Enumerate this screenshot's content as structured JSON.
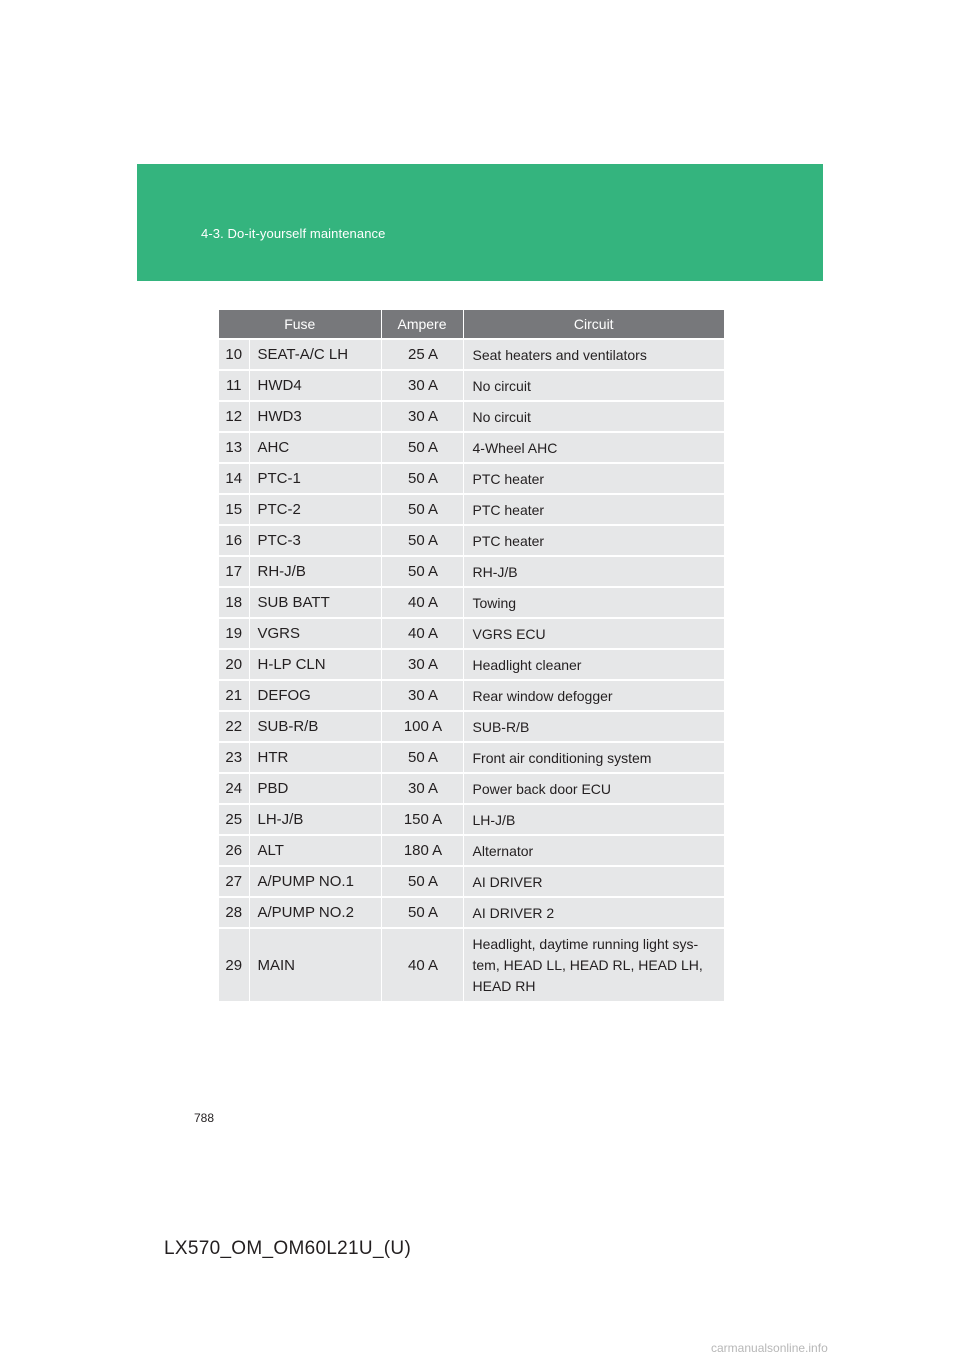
{
  "header": {
    "section": "4-3. Do-it-yourself maintenance",
    "band_color": "#34b47e"
  },
  "table": {
    "columns": [
      "Fuse",
      "Ampere",
      "Circuit"
    ],
    "header_color": "#77787b",
    "row_color": "#e6e7e8",
    "rows": [
      {
        "num": "10",
        "fuse": "SEAT-A/C LH",
        "ampere": "25 A",
        "circuit": "Seat heaters and ventilators"
      },
      {
        "num": "11",
        "fuse": "HWD4",
        "ampere": "30 A",
        "circuit": "No circuit"
      },
      {
        "num": "12",
        "fuse": "HWD3",
        "ampere": "30 A",
        "circuit": "No circuit"
      },
      {
        "num": "13",
        "fuse": "AHC",
        "ampere": "50 A",
        "circuit": "4-Wheel AHC"
      },
      {
        "num": "14",
        "fuse": "PTC-1",
        "ampere": "50 A",
        "circuit": "PTC heater"
      },
      {
        "num": "15",
        "fuse": "PTC-2",
        "ampere": "50 A",
        "circuit": "PTC heater"
      },
      {
        "num": "16",
        "fuse": "PTC-3",
        "ampere": "50 A",
        "circuit": "PTC heater"
      },
      {
        "num": "17",
        "fuse": "RH-J/B",
        "ampere": "50 A",
        "circuit": "RH-J/B"
      },
      {
        "num": "18",
        "fuse": "SUB BATT",
        "ampere": "40 A",
        "circuit": "Towing"
      },
      {
        "num": "19",
        "fuse": "VGRS",
        "ampere": "40 A",
        "circuit": "VGRS ECU"
      },
      {
        "num": "20",
        "fuse": "H-LP CLN",
        "ampere": "30 A",
        "circuit": "Headlight cleaner"
      },
      {
        "num": "21",
        "fuse": "DEFOG",
        "ampere": "30 A",
        "circuit": "Rear window defogger"
      },
      {
        "num": "22",
        "fuse": "SUB-R/B",
        "ampere": "100 A",
        "circuit": "SUB-R/B"
      },
      {
        "num": "23",
        "fuse": "HTR",
        "ampere": "50 A",
        "circuit": "Front air conditioning system"
      },
      {
        "num": "24",
        "fuse": "PBD",
        "ampere": "30 A",
        "circuit": "Power back door ECU"
      },
      {
        "num": "25",
        "fuse": "LH-J/B",
        "ampere": "150 A",
        "circuit": "LH-J/B"
      },
      {
        "num": "26",
        "fuse": "ALT",
        "ampere": "180 A",
        "circuit": "Alternator"
      },
      {
        "num": "27",
        "fuse": "A/PUMP NO.1",
        "ampere": "50 A",
        "circuit": "AI DRIVER"
      },
      {
        "num": "28",
        "fuse": "A/PUMP NO.2",
        "ampere": "50 A",
        "circuit": "AI DRIVER 2"
      },
      {
        "num": "29",
        "fuse": "MAIN",
        "ampere": "40 A",
        "circuit": "Headlight, daytime running light sys-tem, HEAD LL, HEAD RL, HEAD LH, HEAD RH"
      }
    ]
  },
  "footer": {
    "page_number": "788",
    "doc_code": "LX570_OM_OM60L21U_(U)",
    "watermark": "carmanualsonline.info"
  }
}
